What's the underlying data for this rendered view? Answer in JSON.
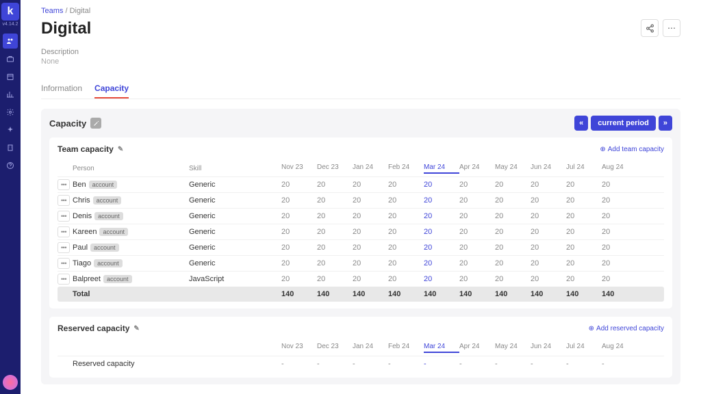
{
  "version": "v4.14.2",
  "breadcrumb": {
    "root": "Teams",
    "sep": "/",
    "current": "Digital"
  },
  "page": {
    "title": "Digital",
    "desc_label": "Description",
    "desc_value": "None"
  },
  "tabs": {
    "info": "Information",
    "capacity": "Capacity"
  },
  "panel": {
    "title": "Capacity",
    "current_period": "current period"
  },
  "team_capacity": {
    "title": "Team capacity",
    "add": "Add team capacity",
    "cols": {
      "person": "Person",
      "skill": "Skill"
    },
    "months": [
      "Nov 23",
      "Dec 23",
      "Jan 24",
      "Feb 24",
      "Mar 24",
      "Apr 24",
      "May 24",
      "Jun 24",
      "Jul 24",
      "Aug 24"
    ],
    "current_idx": 4,
    "rows": [
      {
        "name": "Ben",
        "badge": "account",
        "skill": "Generic",
        "vals": [
          20,
          20,
          20,
          20,
          20,
          20,
          20,
          20,
          20,
          20
        ]
      },
      {
        "name": "Chris",
        "badge": "account",
        "skill": "Generic",
        "vals": [
          20,
          20,
          20,
          20,
          20,
          20,
          20,
          20,
          20,
          20
        ]
      },
      {
        "name": "Denis",
        "badge": "account",
        "skill": "Generic",
        "vals": [
          20,
          20,
          20,
          20,
          20,
          20,
          20,
          20,
          20,
          20
        ]
      },
      {
        "name": "Kareen",
        "badge": "account",
        "skill": "Generic",
        "vals": [
          20,
          20,
          20,
          20,
          20,
          20,
          20,
          20,
          20,
          20
        ]
      },
      {
        "name": "Paul",
        "badge": "account",
        "skill": "Generic",
        "vals": [
          20,
          20,
          20,
          20,
          20,
          20,
          20,
          20,
          20,
          20
        ]
      },
      {
        "name": "Tiago",
        "badge": "account",
        "skill": "Generic",
        "vals": [
          20,
          20,
          20,
          20,
          20,
          20,
          20,
          20,
          20,
          20
        ]
      },
      {
        "name": "Balpreet",
        "badge": "account",
        "skill": "JavaScript",
        "vals": [
          20,
          20,
          20,
          20,
          20,
          20,
          20,
          20,
          20,
          20
        ]
      }
    ],
    "total_label": "Total",
    "totals": [
      140,
      140,
      140,
      140,
      140,
      140,
      140,
      140,
      140,
      140
    ]
  },
  "reserved": {
    "title": "Reserved capacity",
    "add": "Add reserved capacity",
    "row_label": "Reserved capacity",
    "vals": [
      "-",
      "-",
      "-",
      "-",
      "-",
      "-",
      "-",
      "-",
      "-",
      "-"
    ]
  },
  "chart_data": {
    "type": "table",
    "title": "Team capacity",
    "categories": [
      "Nov 23",
      "Dec 23",
      "Jan 24",
      "Feb 24",
      "Mar 24",
      "Apr 24",
      "May 24",
      "Jun 24",
      "Jul 24",
      "Aug 24"
    ],
    "series": [
      {
        "name": "Ben",
        "values": [
          20,
          20,
          20,
          20,
          20,
          20,
          20,
          20,
          20,
          20
        ]
      },
      {
        "name": "Chris",
        "values": [
          20,
          20,
          20,
          20,
          20,
          20,
          20,
          20,
          20,
          20
        ]
      },
      {
        "name": "Denis",
        "values": [
          20,
          20,
          20,
          20,
          20,
          20,
          20,
          20,
          20,
          20
        ]
      },
      {
        "name": "Kareen",
        "values": [
          20,
          20,
          20,
          20,
          20,
          20,
          20,
          20,
          20,
          20
        ]
      },
      {
        "name": "Paul",
        "values": [
          20,
          20,
          20,
          20,
          20,
          20,
          20,
          20,
          20,
          20
        ]
      },
      {
        "name": "Tiago",
        "values": [
          20,
          20,
          20,
          20,
          20,
          20,
          20,
          20,
          20,
          20
        ]
      },
      {
        "name": "Balpreet",
        "values": [
          20,
          20,
          20,
          20,
          20,
          20,
          20,
          20,
          20,
          20
        ]
      },
      {
        "name": "Total",
        "values": [
          140,
          140,
          140,
          140,
          140,
          140,
          140,
          140,
          140,
          140
        ]
      }
    ]
  }
}
